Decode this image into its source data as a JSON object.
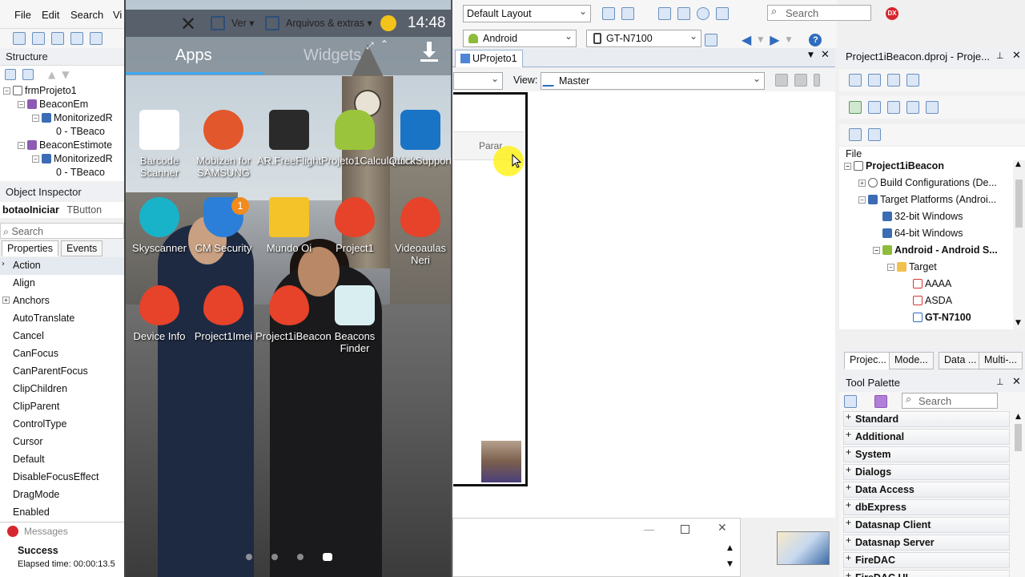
{
  "menu": {
    "file": "File",
    "edit": "Edit",
    "search": "Search",
    "view": "Vi"
  },
  "structure": {
    "title": "Structure",
    "tree": [
      {
        "label": "frmProjeto1",
        "indent": 0
      },
      {
        "label": "BeaconEm",
        "indent": 1
      },
      {
        "label": "MonitorizedR",
        "indent": 2
      },
      {
        "label": "0 - TBeaco",
        "indent": 3
      },
      {
        "label": "BeaconEstimote",
        "indent": 1
      },
      {
        "label": "MonitorizedR",
        "indent": 2
      },
      {
        "label": "0 - TBeaco",
        "indent": 3
      }
    ]
  },
  "object_inspector": {
    "title": "Object Inspector",
    "object_name": "botaoIniciar",
    "object_type": "TButton",
    "search_placeholder": "Search",
    "tabs": [
      "Properties",
      "Events"
    ],
    "properties": [
      "Action",
      "Align",
      "Anchors",
      "AutoTranslate",
      "Cancel",
      "CanFocus",
      "CanParentFocus",
      "ClipChildren",
      "ClipParent",
      "ControlType",
      "Cursor",
      "Default",
      "DisableFocusEffect",
      "DragMode",
      "Enabled"
    ]
  },
  "messages": {
    "title": "Messages",
    "status": "Success",
    "elapsed": "Elapsed time: 00:00:13.5"
  },
  "phone": {
    "toolbar_view": "Ver",
    "toolbar_files": "Arquivos & extras",
    "time": "14:48",
    "tab_apps": "Apps",
    "tab_widgets": "Widgets",
    "apps": [
      {
        "label": "Barcode Scanner",
        "color": "#ffffff"
      },
      {
        "label": "Mobizen for SAMSUNG",
        "color": "#e2572b"
      },
      {
        "label": "AR.FreeFlight",
        "color": "#2a2a2a"
      },
      {
        "label": "Projeto1Calculadora",
        "color": "#9ac43c"
      },
      {
        "label": "QuickSupport",
        "color": "#1a74c6"
      },
      {
        "label": "Skyscanner",
        "color": "#19b3c9"
      },
      {
        "label": "CM Security",
        "color": "#2c7fd8"
      },
      {
        "label": "Mundo Oi",
        "color": "#f4c32a"
      },
      {
        "label": "Project1",
        "color": "#e6432a"
      },
      {
        "label": "Videoaulas Neri",
        "color": "#e6432a"
      },
      {
        "label": "Device Info",
        "color": "#e6432a"
      },
      {
        "label": "Project1Imei",
        "color": "#e6432a"
      },
      {
        "label": "Project1iBeacon",
        "color": "#e6432a"
      },
      {
        "label": "Beacons Finder",
        "color": "#d9eef0"
      }
    ],
    "badge": "1"
  },
  "toolbar": {
    "layout": "Default Layout",
    "search_placeholder": "Search",
    "platform": "Android",
    "device": "GT-N7100",
    "dx_logo": "DX"
  },
  "designer": {
    "tab": "UProjeto1",
    "view_label": "View:",
    "view_value": "Master",
    "button_parar": "Parar"
  },
  "project_manager": {
    "title": "Project1iBeacon.dproj - Proje...",
    "file_label": "File",
    "tree": [
      {
        "label": "Project1iBeacon",
        "bold": true
      },
      {
        "label": "Build Configurations (De...",
        "bold": false
      },
      {
        "label": "Target Platforms (Androi...",
        "bold": false
      },
      {
        "label": "32-bit Windows",
        "bold": false
      },
      {
        "label": "64-bit Windows",
        "bold": false
      },
      {
        "label": "Android - Android S...",
        "bold": true
      },
      {
        "label": "Target",
        "bold": false
      },
      {
        "label": "AAAA",
        "bold": false
      },
      {
        "label": "ASDA",
        "bold": false
      },
      {
        "label": "GT-N7100",
        "bold": true
      }
    ],
    "tabs": [
      "Projec...",
      "Mode...",
      "Data ...",
      "Multi-..."
    ]
  },
  "tool_palette": {
    "title": "Tool Palette",
    "search_placeholder": "Search",
    "categories": [
      "Standard",
      "Additional",
      "System",
      "Dialogs",
      "Data Access",
      "dbExpress",
      "Datasnap Client",
      "Datasnap Server",
      "FireDAC",
      "FireDAC UI"
    ]
  }
}
